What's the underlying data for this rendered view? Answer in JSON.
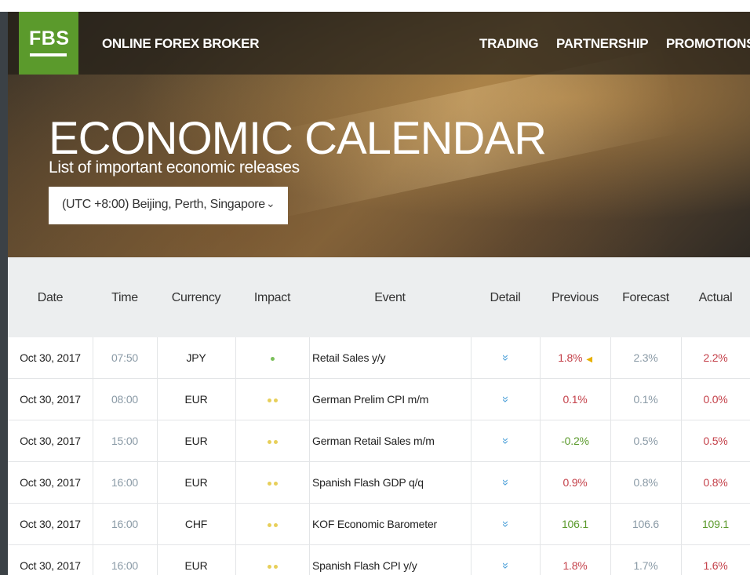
{
  "header": {
    "logo": "FBS",
    "tagline": "ONLINE FOREX BROKER",
    "nav": [
      "TRADING",
      "PARTNERSHIP",
      "PROMOTIONS"
    ]
  },
  "hero": {
    "title": "ECONOMIC CALENDAR",
    "subtitle": "List of important economic releases",
    "timezone": "(UTC +8:00) Beijing, Perth, Singapore"
  },
  "table": {
    "columns": [
      "Date",
      "Time",
      "Currency",
      "Impact",
      "Event",
      "Detail",
      "Previous",
      "Forecast",
      "Actual"
    ],
    "rows": [
      {
        "date": "Oct 30, 2017",
        "time": "07:50",
        "currency": "JPY",
        "impact": 1,
        "event": "Retail Sales y/y",
        "previous": "1.8%",
        "previous_color": "red",
        "previous_marker": true,
        "forecast": "2.3%",
        "actual": "2.2%",
        "actual_color": "red"
      },
      {
        "date": "Oct 30, 2017",
        "time": "08:00",
        "currency": "EUR",
        "impact": 2,
        "event": "German Prelim CPI m/m",
        "previous": "0.1%",
        "previous_color": "red",
        "previous_marker": false,
        "forecast": "0.1%",
        "actual": "0.0%",
        "actual_color": "red"
      },
      {
        "date": "Oct 30, 2017",
        "time": "15:00",
        "currency": "EUR",
        "impact": 2,
        "event": "German Retail Sales m/m",
        "previous": "-0.2%",
        "previous_color": "green",
        "previous_marker": false,
        "forecast": "0.5%",
        "actual": "0.5%",
        "actual_color": "red"
      },
      {
        "date": "Oct 30, 2017",
        "time": "16:00",
        "currency": "EUR",
        "impact": 2,
        "event": "Spanish Flash GDP q/q",
        "previous": "0.9%",
        "previous_color": "red",
        "previous_marker": false,
        "forecast": "0.8%",
        "actual": "0.8%",
        "actual_color": "red"
      },
      {
        "date": "Oct 30, 2017",
        "time": "16:00",
        "currency": "CHF",
        "impact": 2,
        "event": "KOF Economic Barometer",
        "previous": "106.1",
        "previous_color": "green",
        "previous_marker": false,
        "forecast": "106.6",
        "actual": "109.1",
        "actual_color": "green"
      },
      {
        "date": "Oct 30, 2017",
        "time": "16:00",
        "currency": "EUR",
        "impact": 2,
        "event": "Spanish Flash CPI y/y",
        "previous": "1.8%",
        "previous_color": "red",
        "previous_marker": false,
        "forecast": "1.7%",
        "actual": "1.6%",
        "actual_color": "red"
      }
    ]
  },
  "colors": {
    "brand_green": "#5b9a2c",
    "value_red": "#c4414a",
    "value_green": "#5b9a2c",
    "detail_blue": "#4a9fd8",
    "impact_low": "#7bbf5a",
    "impact_medium": "#e7cf5a",
    "marker_yellow": "#e7b000"
  },
  "icons": {
    "detail": "double-chevron-down-icon",
    "select": "chevron-down-icon",
    "previous_marker": "triangle-left-icon"
  }
}
